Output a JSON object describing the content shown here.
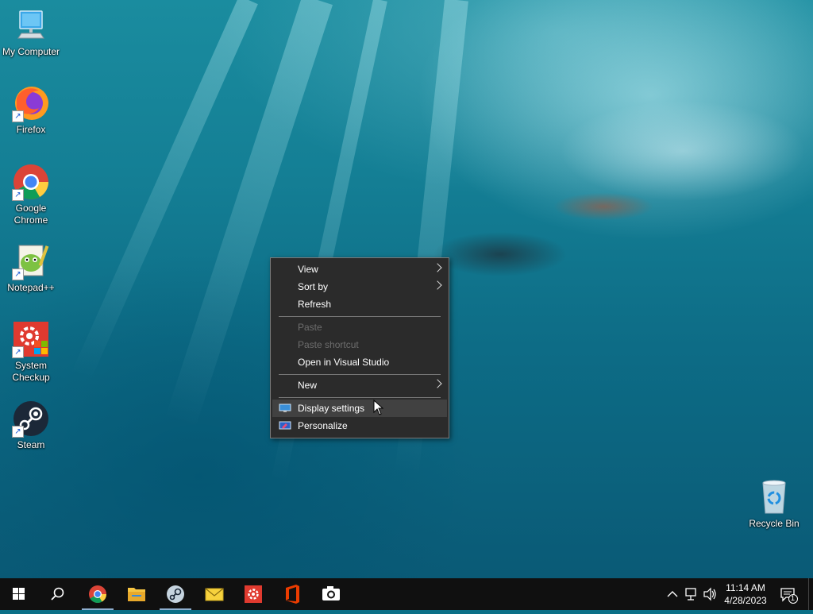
{
  "desktop": {
    "icons": [
      {
        "name": "my-computer",
        "label": "My Computer"
      },
      {
        "name": "firefox",
        "label": "Firefox"
      },
      {
        "name": "google-chrome",
        "label": "Google Chrome"
      },
      {
        "name": "notepad-plus-plus",
        "label": "Notepad++"
      },
      {
        "name": "system-checkup",
        "label": "System Checkup"
      },
      {
        "name": "steam",
        "label": "Steam"
      },
      {
        "name": "recycle-bin",
        "label": "Recycle Bin"
      }
    ]
  },
  "context_menu": {
    "items": [
      {
        "label": "View",
        "submenu": true,
        "disabled": false
      },
      {
        "label": "Sort by",
        "submenu": true,
        "disabled": false
      },
      {
        "label": "Refresh",
        "submenu": false,
        "disabled": false
      },
      {
        "label": "Paste",
        "submenu": false,
        "disabled": true
      },
      {
        "label": "Paste shortcut",
        "submenu": false,
        "disabled": true
      },
      {
        "label": "Open in Visual Studio",
        "submenu": false,
        "disabled": false
      },
      {
        "label": "New",
        "submenu": true,
        "disabled": false
      },
      {
        "label": "Display settings",
        "submenu": false,
        "disabled": false,
        "highlighted": true
      },
      {
        "label": "Personalize",
        "submenu": false,
        "disabled": false
      }
    ]
  },
  "taskbar": {
    "apps": [
      "start-icon",
      "search-icon",
      "chrome-icon",
      "file-explorer-icon",
      "steam-icon",
      "mail-icon",
      "system-checkup-icon",
      "office-icon",
      "camera-icon"
    ],
    "clock": {
      "time": "11:14 AM",
      "date": "4/28/2023"
    },
    "notification_count": "1"
  },
  "colors": {
    "menu_bg": "#2b2b2b",
    "taskbar_bg": "#101010",
    "highlight": "#414141"
  }
}
